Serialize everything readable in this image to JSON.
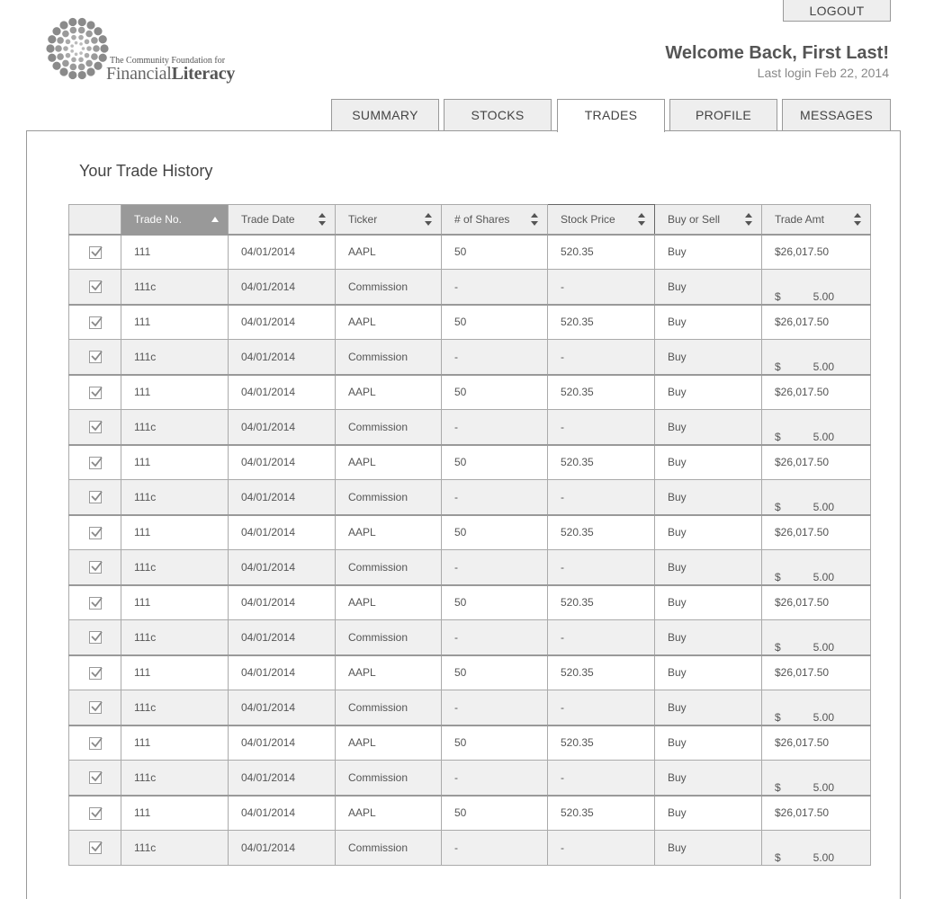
{
  "header": {
    "logout_label": "LOGOUT",
    "logo": {
      "line1": "The Community Foundation for",
      "line2a": "Financial",
      "line2b": "Literacy"
    },
    "welcome": "Welcome Back, First Last!",
    "last_login": "Last login Feb 22, 2014"
  },
  "tabs": [
    {
      "label": "SUMMARY",
      "active": false
    },
    {
      "label": "STOCKS",
      "active": false
    },
    {
      "label": "TRADES",
      "active": true
    },
    {
      "label": "PROFILE",
      "active": false
    },
    {
      "label": "MESSAGES",
      "active": false
    }
  ],
  "main": {
    "title": "Your Trade History",
    "columns": [
      "Trade No.",
      "Trade Date",
      "Ticker",
      "# of Shares",
      "Stock Price",
      "Buy or Sell",
      "Trade Amt"
    ],
    "sorted_column": "Trade No.",
    "rows": [
      {
        "checked": true,
        "trade_no": "111",
        "date": "04/01/2014",
        "ticker": "AAPL",
        "shares": "50",
        "price": "520.35",
        "side": "Buy",
        "amount": "$26,017.50"
      },
      {
        "checked": true,
        "trade_no": "111c",
        "date": "04/01/2014",
        "ticker": "Commission",
        "shares": "-",
        "price": "-",
        "side": "Buy",
        "amount_symbol": "$",
        "amount_value": "5.00"
      },
      {
        "checked": true,
        "trade_no": "111",
        "date": "04/01/2014",
        "ticker": "AAPL",
        "shares": "50",
        "price": "520.35",
        "side": "Buy",
        "amount": "$26,017.50"
      },
      {
        "checked": true,
        "trade_no": "111c",
        "date": "04/01/2014",
        "ticker": "Commission",
        "shares": "-",
        "price": "-",
        "side": "Buy",
        "amount_symbol": "$",
        "amount_value": "5.00"
      },
      {
        "checked": true,
        "trade_no": "111",
        "date": "04/01/2014",
        "ticker": "AAPL",
        "shares": "50",
        "price": "520.35",
        "side": "Buy",
        "amount": "$26,017.50"
      },
      {
        "checked": true,
        "trade_no": "111c",
        "date": "04/01/2014",
        "ticker": "Commission",
        "shares": "-",
        "price": "-",
        "side": "Buy",
        "amount_symbol": "$",
        "amount_value": "5.00"
      },
      {
        "checked": true,
        "trade_no": "111",
        "date": "04/01/2014",
        "ticker": "AAPL",
        "shares": "50",
        "price": "520.35",
        "side": "Buy",
        "amount": "$26,017.50"
      },
      {
        "checked": true,
        "trade_no": "111c",
        "date": "04/01/2014",
        "ticker": "Commission",
        "shares": "-",
        "price": "-",
        "side": "Buy",
        "amount_symbol": "$",
        "amount_value": "5.00"
      },
      {
        "checked": true,
        "trade_no": "111",
        "date": "04/01/2014",
        "ticker": "AAPL",
        "shares": "50",
        "price": "520.35",
        "side": "Buy",
        "amount": "$26,017.50"
      },
      {
        "checked": true,
        "trade_no": "111c",
        "date": "04/01/2014",
        "ticker": "Commission",
        "shares": "-",
        "price": "-",
        "side": "Buy",
        "amount_symbol": "$",
        "amount_value": "5.00"
      },
      {
        "checked": true,
        "trade_no": "111",
        "date": "04/01/2014",
        "ticker": "AAPL",
        "shares": "50",
        "price": "520.35",
        "side": "Buy",
        "amount": "$26,017.50"
      },
      {
        "checked": true,
        "trade_no": "111c",
        "date": "04/01/2014",
        "ticker": "Commission",
        "shares": "-",
        "price": "-",
        "side": "Buy",
        "amount_symbol": "$",
        "amount_value": "5.00"
      },
      {
        "checked": true,
        "trade_no": "111",
        "date": "04/01/2014",
        "ticker": "AAPL",
        "shares": "50",
        "price": "520.35",
        "side": "Buy",
        "amount": "$26,017.50"
      },
      {
        "checked": true,
        "trade_no": "111c",
        "date": "04/01/2014",
        "ticker": "Commission",
        "shares": "-",
        "price": "-",
        "side": "Buy",
        "amount_symbol": "$",
        "amount_value": "5.00"
      },
      {
        "checked": true,
        "trade_no": "111",
        "date": "04/01/2014",
        "ticker": "AAPL",
        "shares": "50",
        "price": "520.35",
        "side": "Buy",
        "amount": "$26,017.50"
      },
      {
        "checked": true,
        "trade_no": "111c",
        "date": "04/01/2014",
        "ticker": "Commission",
        "shares": "-",
        "price": "-",
        "side": "Buy",
        "amount_symbol": "$",
        "amount_value": "5.00"
      },
      {
        "checked": true,
        "trade_no": "111",
        "date": "04/01/2014",
        "ticker": "AAPL",
        "shares": "50",
        "price": "520.35",
        "side": "Buy",
        "amount": "$26,017.50"
      },
      {
        "checked": true,
        "trade_no": "111c",
        "date": "04/01/2014",
        "ticker": "Commission",
        "shares": "-",
        "price": "-",
        "side": "Buy",
        "amount_symbol": "$",
        "amount_value": "5.00"
      }
    ]
  },
  "colors": {
    "sorted_header_bg": "#999999",
    "header_bg": "#eeeeee",
    "alt_row_bg": "#f0f0f0",
    "border": "#aaaaaa",
    "text": "#555555"
  }
}
